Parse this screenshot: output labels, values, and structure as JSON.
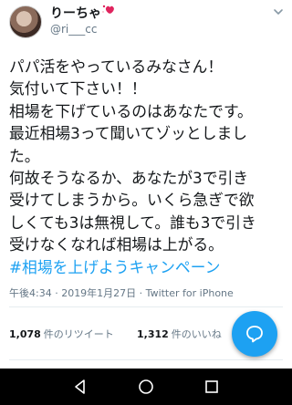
{
  "header": {
    "display_name": "りーちゃ",
    "handle": "@ri___cc",
    "badge_icon": "heart-sparkle-icon",
    "menu_icon": "chevron-down-icon"
  },
  "tweet": {
    "lines": [
      "パパ活をやっているみなさん！",
      "気付いて下さい！！",
      "相場を下げているのはあなたです。",
      "最近相場3って聞いてゾッとしまし",
      "た。",
      "何故そうなるか、あなたが3で引き",
      "受けてしまうから。いくら急ぎで欲",
      "しくても3は無視して。誰も3で引き",
      "受けなくなれば相場は上がる。"
    ],
    "hashtag": "#相場を上げようキャンペーン"
  },
  "meta": {
    "timestamp": "午後4:34 · 2019年1月27日 · Twitter for iPhone"
  },
  "stats": {
    "retweets_count": "1,078",
    "retweets_label": "件のリツイート",
    "likes_count": "1,312",
    "likes_label": "件のいいね"
  },
  "fab": {
    "icon": "reply-bubble-icon",
    "color": "#1da1f2"
  },
  "colors": {
    "link": "#1da1f2",
    "secondary_text": "#657786",
    "navbar": "#000000"
  },
  "navbar": {
    "icons": [
      "back-icon",
      "home-icon",
      "recents-icon"
    ]
  }
}
